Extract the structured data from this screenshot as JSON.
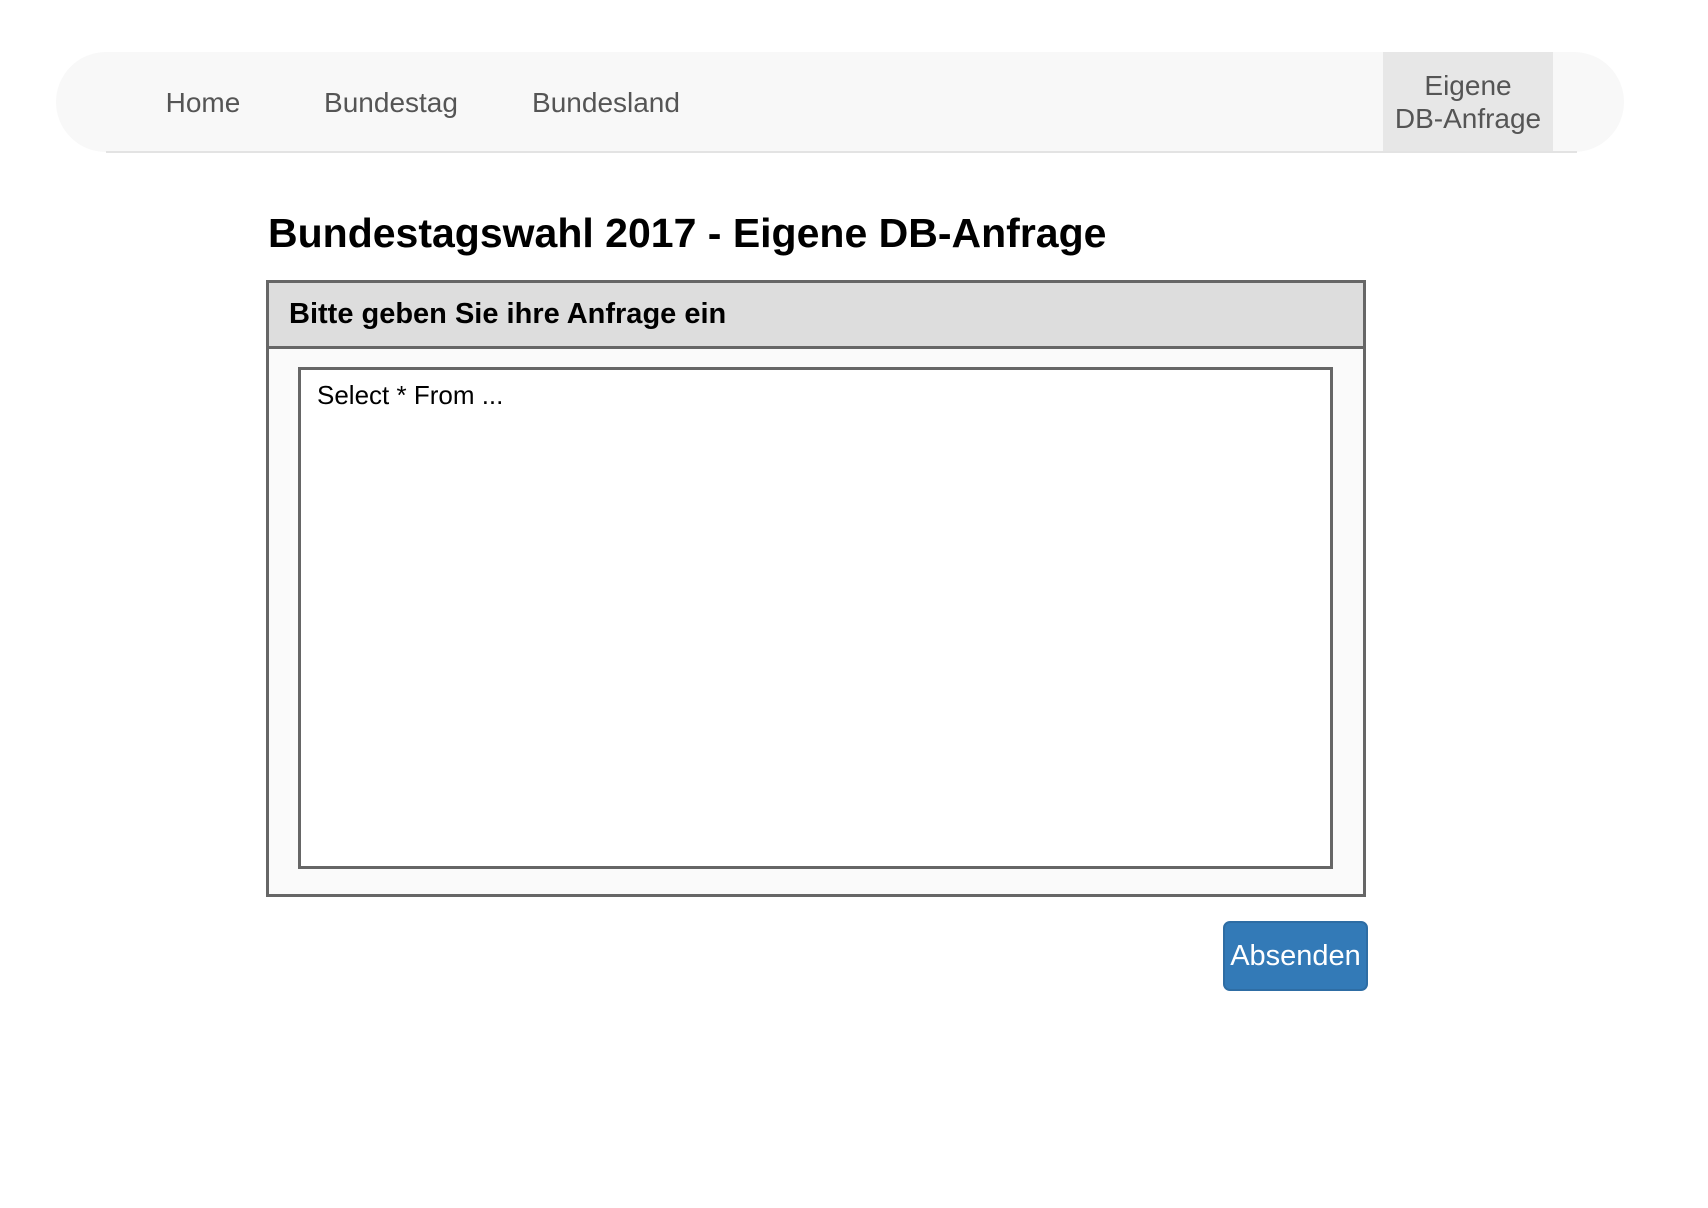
{
  "nav": {
    "items": [
      {
        "label": "Home"
      },
      {
        "label": "Bundestag"
      },
      {
        "label": "Bundesland"
      }
    ],
    "active": {
      "line1": "Eigene",
      "line2": "DB-Anfrage"
    }
  },
  "main": {
    "title": "Bundestagswahl 2017 - Eigene DB-Anfrage",
    "panel": {
      "heading": "Bitte geben Sie ihre Anfrage ein",
      "query_placeholder": "Select * From ..."
    },
    "submit_label": "Absenden"
  },
  "colors": {
    "primary_button": "#337ab7",
    "navbar_bg": "#f8f8f8",
    "active_nav_bg": "#e7e7e7",
    "panel_heading_bg": "#dddddd",
    "border": "#666666"
  }
}
